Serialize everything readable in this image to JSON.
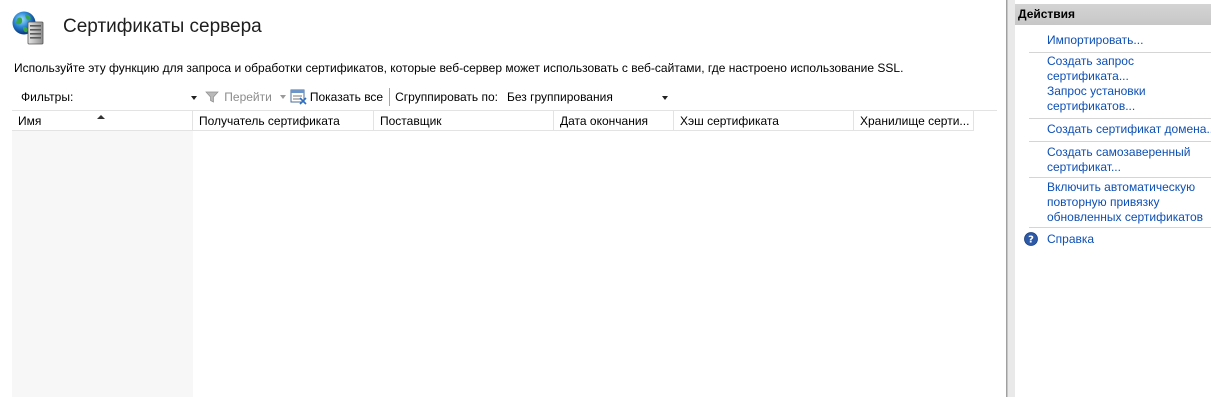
{
  "page": {
    "title": "Сертификаты сервера",
    "description": "Используйте эту функцию для запроса и обработки сертификатов, которые веб-сервер может использовать с веб-сайтами, где настроено использование SSL.",
    "header_icon": "server-certificates-icon"
  },
  "toolbar": {
    "filters_label": "Фильтры:",
    "filter_value": "",
    "go_label": "Перейти",
    "show_all_label": "Показать все",
    "group_by_label": "Сгруппировать по:",
    "group_by_value": "Без группирования"
  },
  "grid": {
    "columns": [
      "Имя",
      "Получатель сертификата",
      "Поставщик",
      "Дата окончания",
      "Хэш сертификата",
      "Хранилище серти..."
    ],
    "sort_column": "Имя",
    "sort_direction": "ascending",
    "rows": []
  },
  "actions": {
    "header": "Действия",
    "import": "Импортировать...",
    "create_request": [
      "Создать запрос",
      "сертификата..."
    ],
    "complete_request": [
      "Запрос установки",
      "сертификатов..."
    ],
    "create_domain": "Создать сертификат домена...",
    "create_self_signed": [
      "Создать самозаверенный",
      "сертификат..."
    ],
    "auto_rebind": [
      "Включить автоматическую",
      "повторную привязку",
      "обновленных сертификатов"
    ],
    "help": "Справка"
  },
  "colors": {
    "link": "#0d4fb5",
    "actions_header": "#cfcfcf",
    "actions_bg": "#e9e9e9",
    "name_column_bg": "#f7f7f7",
    "disabled_text": "#8c8c8c"
  }
}
